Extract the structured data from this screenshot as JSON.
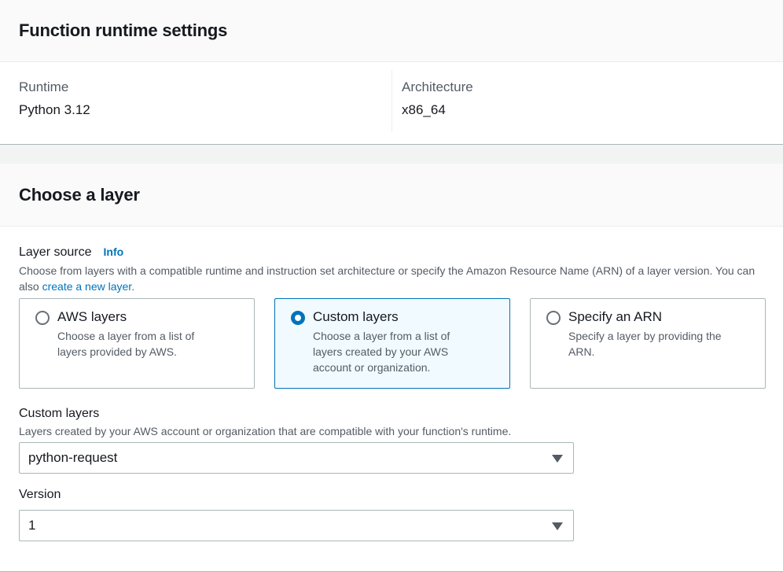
{
  "runtime_panel": {
    "title": "Function runtime settings",
    "runtime_label": "Runtime",
    "runtime_value": "Python 3.12",
    "architecture_label": "Architecture",
    "architecture_value": "x86_64"
  },
  "layer_panel": {
    "title": "Choose a layer",
    "layer_source": {
      "label": "Layer source",
      "info": "Info",
      "description_prefix": "Choose from layers with a compatible runtime and instruction set architecture or specify the Amazon Resource Name (ARN) of a layer version. You can also ",
      "description_link": "create a new layer",
      "description_suffix": "."
    },
    "tiles": [
      {
        "title": "AWS layers",
        "description": "Choose a layer from a list of layers provided by AWS.",
        "selected": false
      },
      {
        "title": "Custom layers",
        "description": "Choose a layer from a list of layers created by your AWS account or organization.",
        "selected": true
      },
      {
        "title": "Specify an ARN",
        "description": "Specify a layer by providing the ARN.",
        "selected": false
      }
    ],
    "custom_layers": {
      "label": "Custom layers",
      "description": "Layers created by your AWS account or organization that are compatible with your function's runtime.",
      "selected_value": "python-request"
    },
    "version": {
      "label": "Version",
      "selected_value": "1"
    }
  },
  "icons": {
    "dropdown": "caret-down-icon",
    "radio": "radio-icon"
  },
  "colors": {
    "accent": "#0073bb",
    "selected_tile_bg": "#f1faff",
    "border": "#aab7b8"
  }
}
